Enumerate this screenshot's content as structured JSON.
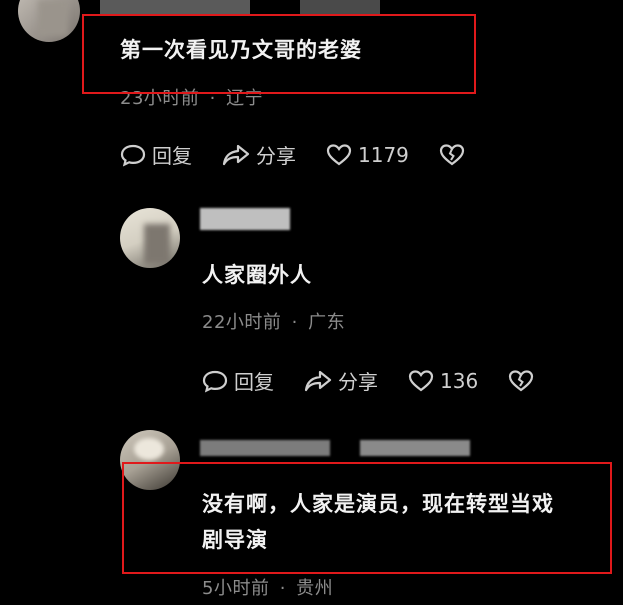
{
  "comments": [
    {
      "text": "第一次看见乃文哥的老婆",
      "time": "23小时前",
      "location": "辽宁",
      "reply_label": "回复",
      "share_label": "分享",
      "likes": "1179"
    },
    {
      "text": "人家圈外人",
      "time": "22小时前",
      "location": "广东",
      "reply_label": "回复",
      "share_label": "分享",
      "likes": "136"
    },
    {
      "text_line1": "没有啊，人家是演员，现在转型当戏",
      "text_line2": "剧导演",
      "time": "5小时前",
      "location": "贵州"
    }
  ],
  "separator": "·",
  "colors": {
    "background": "#000000",
    "highlight_box": "#e0191b",
    "meta_text": "#8c8c8c"
  },
  "icons": [
    "comment-bubble-icon",
    "share-arrow-icon",
    "heart-icon",
    "broken-heart-icon"
  ]
}
